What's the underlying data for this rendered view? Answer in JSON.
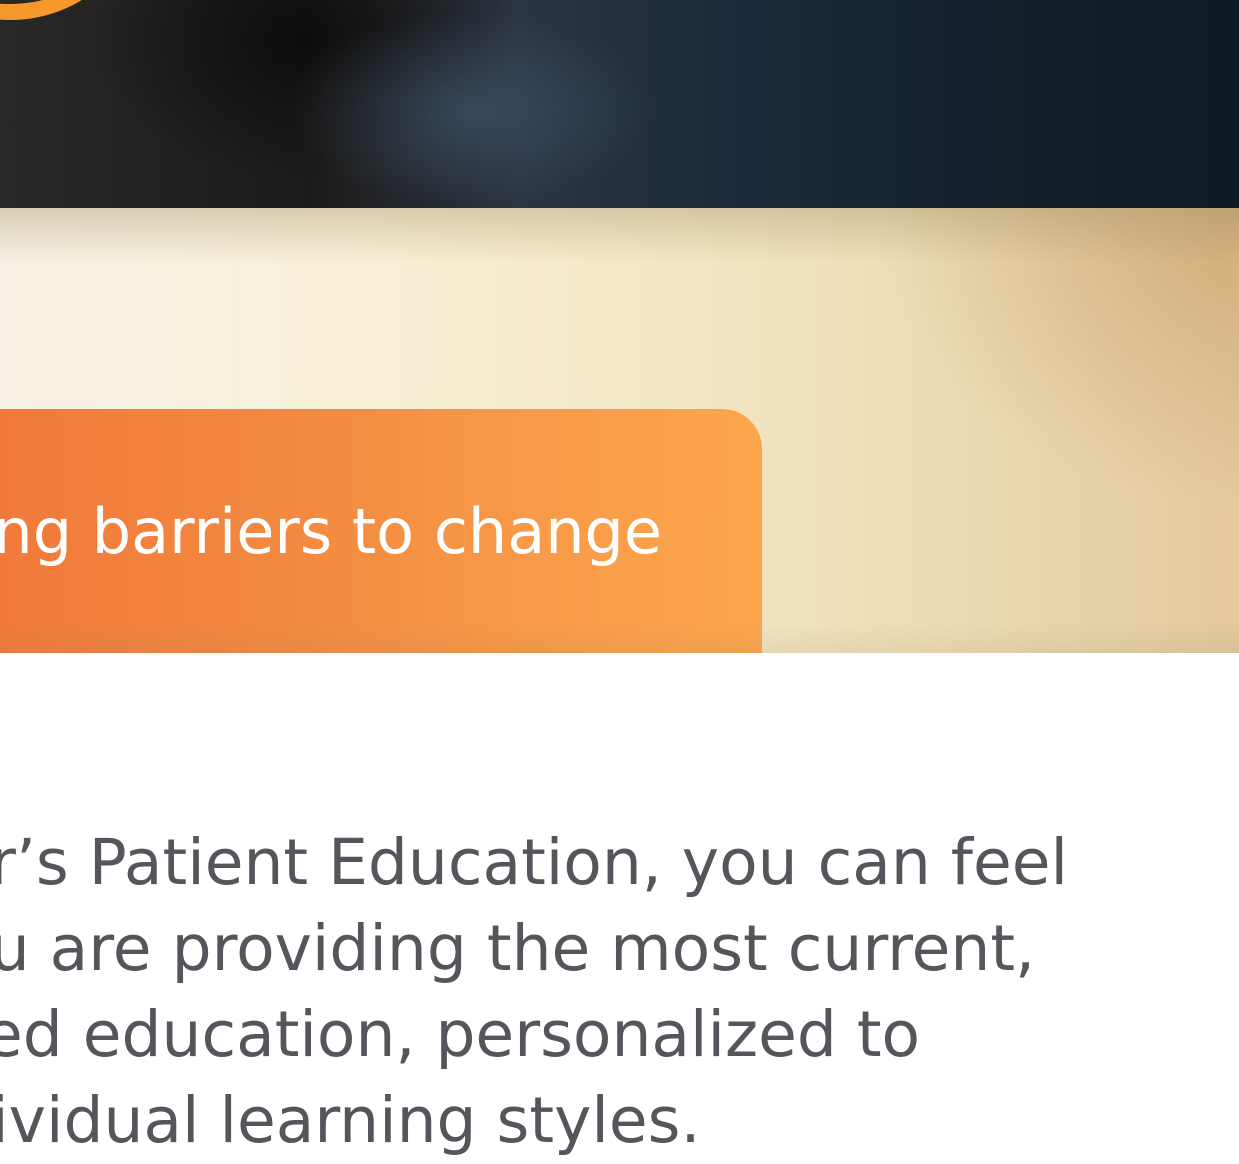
{
  "hero": {
    "headline_visible": "ng barriers to change"
  },
  "intro": {
    "lines": [
      "er’s Patient Education, you can feel",
      "ou are providing the most current,",
      "sed education, personalized to",
      "dividual learning styles."
    ]
  },
  "colors": {
    "accent_orange": "#f38a40",
    "body_text": "#55555c",
    "banner_dark": "#1b2a3a"
  }
}
